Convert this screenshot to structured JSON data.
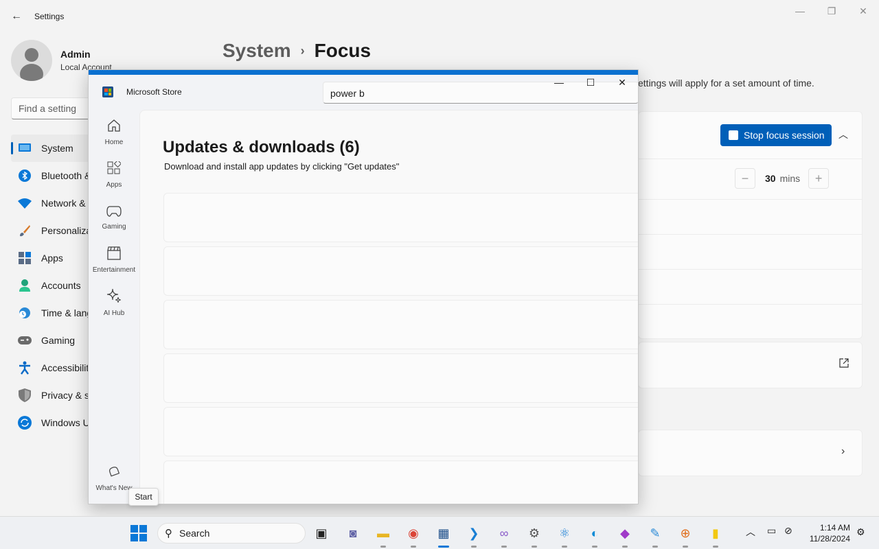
{
  "settings": {
    "title": "Settings",
    "profile": {
      "name": "Admin",
      "account": "Local Account"
    },
    "search_placeholder": "Find a setting",
    "nav": [
      {
        "label": "System",
        "icon": "monitor-icon",
        "color": "#0a78d7"
      },
      {
        "label": "Bluetooth &",
        "icon": "bluetooth-icon",
        "color": "#0a78d7"
      },
      {
        "label": "Network &",
        "icon": "wifi-icon",
        "color": "#0a78d7"
      },
      {
        "label": "Personaliza",
        "icon": "brush-icon",
        "color": "#d77a2a"
      },
      {
        "label": "Apps",
        "icon": "apps-icon",
        "color": "#5a6c86"
      },
      {
        "label": "Accounts",
        "icon": "person-icon",
        "color": "#1fa37a"
      },
      {
        "label": "Time & lang",
        "icon": "clock-globe-icon",
        "color": "#2a8ad7"
      },
      {
        "label": "Gaming",
        "icon": "gamepad-icon",
        "color": "#6a6a6a"
      },
      {
        "label": "Accessibilit",
        "icon": "accessibility-icon",
        "color": "#0a6ac7"
      },
      {
        "label": "Privacy & s",
        "icon": "shield-icon",
        "color": "#7a7a7a"
      },
      {
        "label": "Windows U",
        "icon": "update-icon",
        "color": "#0a78d7"
      }
    ],
    "breadcrumb": {
      "parent": "System",
      "current": "Focus"
    },
    "focus_description": "ettings will apply for a set amount of time.",
    "stop_button": "Stop focus session",
    "duration": {
      "value": "30",
      "unit": "mins"
    }
  },
  "store": {
    "title": "Microsoft Store",
    "search_value": "power b",
    "nav": [
      {
        "label": "Home",
        "icon": "home-icon",
        "glyph": "⌂"
      },
      {
        "label": "Apps",
        "icon": "apps-grid-icon",
        "glyph": "⊞"
      },
      {
        "label": "Gaming",
        "icon": "controller-icon",
        "glyph": "⌨"
      },
      {
        "label": "Entertainment",
        "icon": "clapperboard-icon",
        "glyph": "▤"
      },
      {
        "label": "AI Hub",
        "icon": "sparkle-icon",
        "glyph": "✧"
      }
    ],
    "whats_new": "What's New",
    "updates_title": "Updates & downloads (6)",
    "updates_subtitle": "Download and install app updates by clicking \"Get updates\""
  },
  "tooltip": "Start",
  "taskbar": {
    "search_label": "Search",
    "clock_time": "1:14 AM",
    "clock_date": "11/28/2024",
    "apps": [
      {
        "name": "task-view-icon",
        "glyph": "▣",
        "color": "#222222"
      },
      {
        "name": "teams-icon",
        "glyph": "◙",
        "color": "#6264a7"
      },
      {
        "name": "file-explorer-icon",
        "glyph": "▬",
        "color": "#e8b624"
      },
      {
        "name": "chrome-icon",
        "glyph": "◉",
        "color": "#db4437"
      },
      {
        "name": "microsoft-store-icon",
        "glyph": "▦",
        "color": "#1e4f8a"
      },
      {
        "name": "vscode-icon",
        "glyph": "❯",
        "color": "#1a7fd4"
      },
      {
        "name": "visual-studio-icon",
        "glyph": "∞",
        "color": "#8a5cc9"
      },
      {
        "name": "settings-icon",
        "glyph": "⚙",
        "color": "#555555"
      },
      {
        "name": "atom-icon",
        "glyph": "⚛",
        "color": "#1a7fd4"
      },
      {
        "name": "edge-icon",
        "glyph": "◐",
        "color": "#0c8bd6"
      },
      {
        "name": "app-diamond-icon",
        "glyph": "◆",
        "color": "#a03ac9"
      },
      {
        "name": "app-feather-icon",
        "glyph": "✎",
        "color": "#2a8ad7"
      },
      {
        "name": "app-globe-icon",
        "glyph": "⊕",
        "color": "#e07020"
      },
      {
        "name": "power-bi-icon",
        "glyph": "▮",
        "color": "#f2c811"
      }
    ]
  }
}
